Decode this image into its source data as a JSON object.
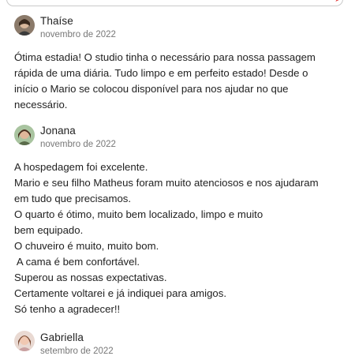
{
  "reviews": [
    {
      "name": "Thaíse",
      "date": "novembro de 2022",
      "lines": [
        "Ótima estadia! O studio tinha o necessário para nossa passagem",
        "rápida de uma diária. Tudo limpo e em perfeito estado! Desde o",
        "início o Mario se colocou disponível para nos ajudar no que",
        "necessário."
      ]
    },
    {
      "name": "Jonana",
      "date": "novembro de 2022",
      "lines": [
        "A hospedagem foi excelente.",
        "Mario e seu filho Matheus foram muito atenciosos e nos ajudaram",
        "em tudo que precisamos.",
        "O quarto é ótimo, muito bem localizado, limpo e muito",
        "bem equipado.",
        "O chuveiro é muito, muito bom.",
        " A cama é bem confortável.",
        "Superou as nossas expectativas.",
        "Certamente voltarei e já indiquei para amigos.",
        "Só tenho a agradecer!!"
      ]
    },
    {
      "name": "Gabriella",
      "date": "setembro de 2022",
      "lines": []
    }
  ],
  "icons": {
    "top_right": "send-arrow-icon"
  },
  "colors": {
    "accent": "#e23a3a",
    "text": "#222222",
    "muted": "#777777"
  }
}
